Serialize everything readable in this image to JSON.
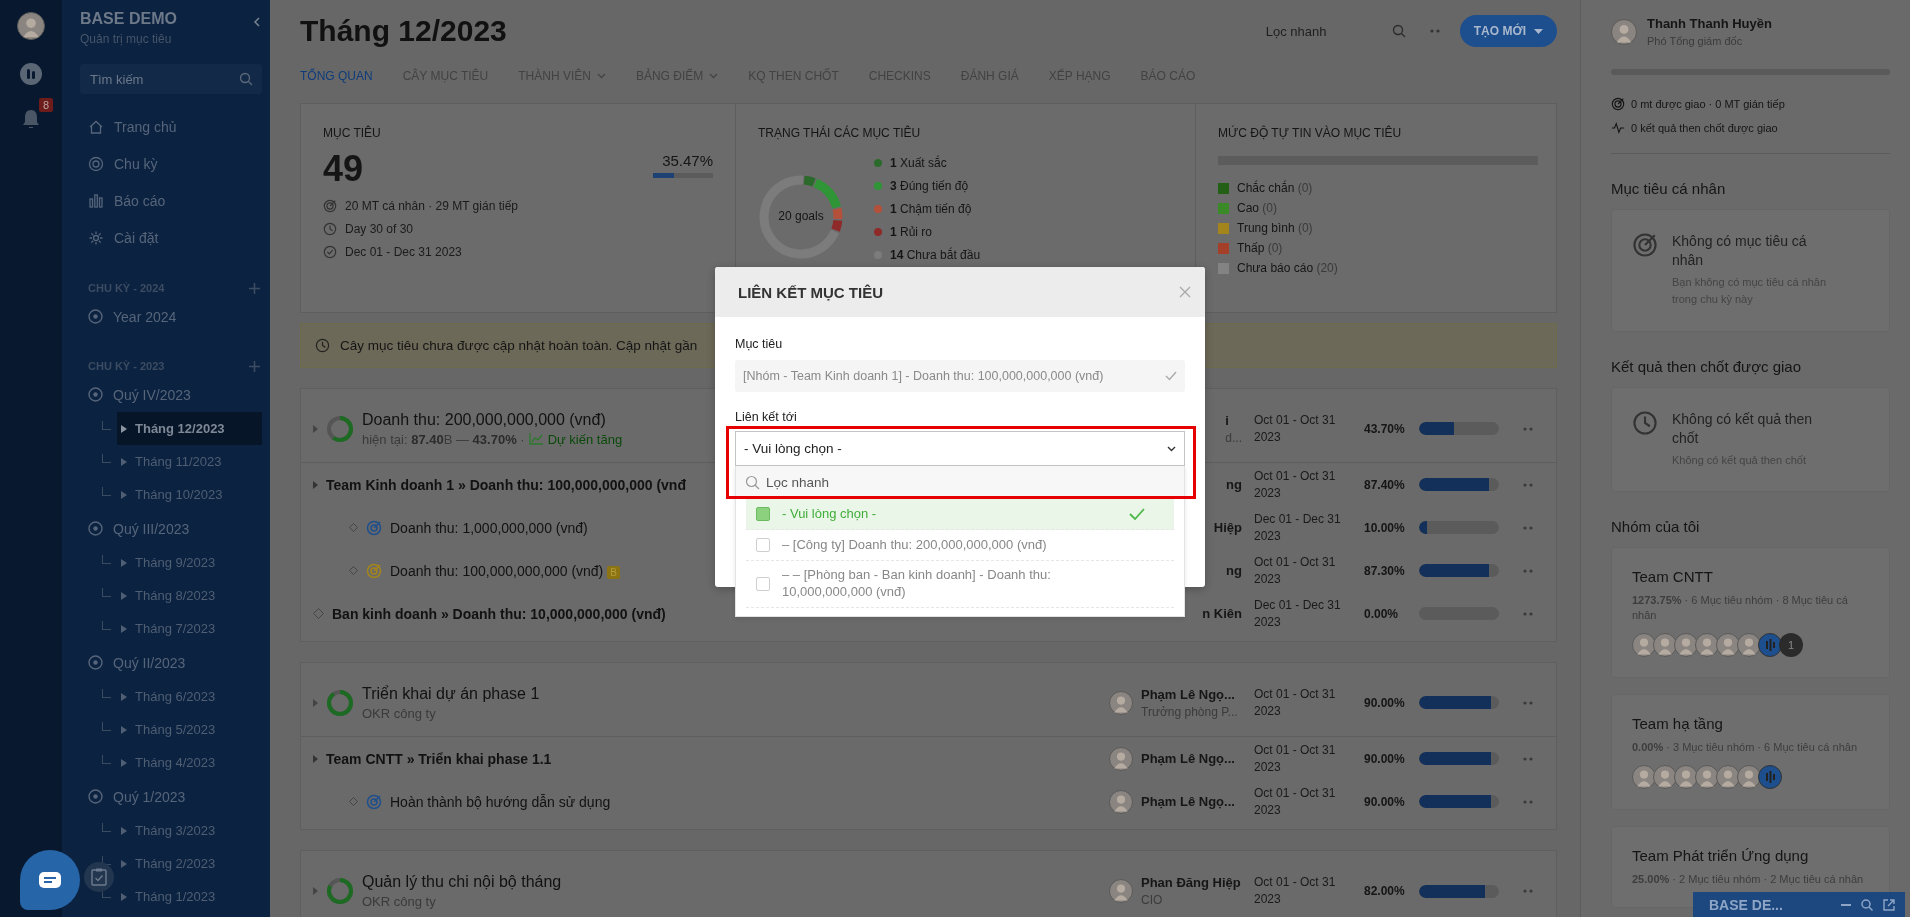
{
  "rail": {
    "notifications": "8"
  },
  "sidebar": {
    "title": "BASE DEMO",
    "subtitle": "Quản trị mục tiêu",
    "search": {
      "placeholder": "Tìm kiếm"
    },
    "nav": [
      {
        "label": "Trang chủ"
      },
      {
        "label": "Chu kỳ"
      },
      {
        "label": "Báo cáo"
      },
      {
        "label": "Cài đặt"
      }
    ],
    "cycles": [
      {
        "title": "CHU KỲ - 2024",
        "items": [
          {
            "label": "Year 2024",
            "selected": false
          }
        ]
      },
      {
        "title": "CHU KỲ - 2023",
        "items": [
          {
            "label": "Quý IV/2023",
            "selected": false,
            "children": [
              {
                "label": "Tháng 12/2023",
                "selected": true
              },
              {
                "label": "Tháng 11/2023",
                "selected": false
              },
              {
                "label": "Tháng 10/2023",
                "selected": false
              }
            ]
          },
          {
            "label": "Quý III/2023",
            "selected": false,
            "children": [
              {
                "label": "Tháng 9/2023",
                "selected": false
              },
              {
                "label": "Tháng 8/2023",
                "selected": false
              },
              {
                "label": "Tháng 7/2023",
                "selected": false
              }
            ]
          },
          {
            "label": "Quý II/2023",
            "selected": false,
            "children": [
              {
                "label": "Tháng 6/2023",
                "selected": false
              },
              {
                "label": "Tháng 5/2023",
                "selected": false
              },
              {
                "label": "Tháng 4/2023",
                "selected": false
              }
            ]
          },
          {
            "label": "Quý 1/2023",
            "selected": false,
            "children": [
              {
                "label": "Tháng 3/2023",
                "selected": false
              },
              {
                "label": "Tháng 2/2023",
                "selected": false
              },
              {
                "label": "Tháng 1/2023",
                "selected": false
              }
            ]
          }
        ]
      }
    ]
  },
  "header": {
    "title": "Tháng 12/2023",
    "search": {
      "placeholder": "Lọc nhanh"
    },
    "create_button": "TẠO MỚI"
  },
  "tabs": [
    {
      "label": "TỔNG QUAN",
      "selected": true,
      "dropdown": false
    },
    {
      "label": "CÂY MỤC TIÊU",
      "selected": false,
      "dropdown": false
    },
    {
      "label": "THÀNH VIÊN",
      "selected": false,
      "dropdown": true
    },
    {
      "label": "BẢNG ĐIỂM",
      "selected": false,
      "dropdown": true
    },
    {
      "label": "KQ THEN CHỐT",
      "selected": false,
      "dropdown": false
    },
    {
      "label": "CHECKINS",
      "selected": false,
      "dropdown": false
    },
    {
      "label": "ĐÁNH GIÁ",
      "selected": false,
      "dropdown": false
    },
    {
      "label": "XẾP HẠNG",
      "selected": false,
      "dropdown": false
    },
    {
      "label": "BÁO CÁO",
      "selected": false,
      "dropdown": false
    }
  ],
  "overview": {
    "objectives": {
      "label": "MỤC TIÊU",
      "value": "49",
      "percent": "35.47%",
      "level": 0.3547,
      "facts": [
        {
          "text": "20 MT cá nhân · 29 MT gián tiếp"
        },
        {
          "text": "Day 30 of 30"
        },
        {
          "text": "Dec 01 - Dec 31 2023"
        }
      ]
    },
    "status": {
      "label": "TRẠNG THÁI CÁC MỤC TIÊU",
      "center": "20 goals",
      "legend": [
        {
          "count": "1",
          "label": "Xuất sắc",
          "color": "#2c6a2c"
        },
        {
          "count": "3",
          "label": "Đúng tiến độ",
          "color": "#2f9536"
        },
        {
          "count": "1",
          "label": "Chậm tiến độ",
          "color": "#b5503a"
        },
        {
          "count": "1",
          "label": "Rủi ro",
          "color": "#8e2a2a"
        },
        {
          "count": "14",
          "label": "Chưa bắt đầu",
          "color": "#7c7c7c"
        }
      ]
    },
    "confidence": {
      "label": "MỨC ĐỘ TỰ TIN VÀO MỤC TIÊU",
      "legend": [
        {
          "label": "Chắc chắn",
          "count": "(0)",
          "color": "#245f16"
        },
        {
          "label": "Cao",
          "count": "(0)",
          "color": "#3a8a28"
        },
        {
          "label": "Trung bình",
          "count": "(0)",
          "color": "#a3851c"
        },
        {
          "label": "Thấp",
          "count": "(0)",
          "color": "#a4402a"
        },
        {
          "label": "Chưa báo cáo",
          "count": "(20)",
          "color": "#838383"
        }
      ]
    }
  },
  "notice": "Cây mục tiêu chưa được cập nhật hoàn toàn. Cập nhật gần",
  "groups": [
    {
      "rows": [
        {
          "kind": "objective",
          "title": "Doanh thu: 200,000,000,000 (vnđ)",
          "subtitle": "hiện tại: **87.40**B — **43.70%** ·",
          "trend": "Dự kiến tăng",
          "owner": {
            "avatar": false,
            "name": "i",
            "role": "d..."
          },
          "dates": "Oct 01 - Oct 31 2023",
          "percent": "43.70%",
          "level": 0.437,
          "children": [
            {
              "kind": "team",
              "title": "Team Kinh doanh 1 » Doanh thu: 100,000,000,000 (vnđ",
              "owner": {
                "avatar": false,
                "name": "ng"
              },
              "dates": "Oct 01 - Oct 31 2023",
              "percent": "87.40%",
              "level": 0.874,
              "children": [
                {
                  "kind": "kr",
                  "color": "#1f4f8c",
                  "title": "Doanh thu: 1,000,000,000 (vnđ)",
                  "owner": {
                    "avatar": false,
                    "name": "Hiệp"
                  },
                  "dates": "Dec 01 - Dec 31 2023",
                  "percent": "10.00%",
                  "level": 0.1
                },
                {
                  "kind": "kr",
                  "color": "#a3851c",
                  "title": "Doanh thu: 100,000,000,000 (vnđ)",
                  "badge": "B",
                  "owner": {
                    "avatar": false,
                    "name": "ng"
                  },
                  "dates": "Oct 01 - Oct 31 2023",
                  "percent": "87.30%",
                  "level": 0.873
                }
              ]
            },
            {
              "kind": "link",
              "title": "Ban kinh doanh » Doanh thu: 10,000,000,000 (vnđ)",
              "owner": {
                "avatar": false,
                "name": "n Kiên"
              },
              "dates": "Dec 01 - Dec 31 2023",
              "percent": "0.00%",
              "level": 0
            }
          ]
        }
      ]
    },
    {
      "rows": [
        {
          "kind": "objective",
          "title": "Triển khai dự án phase 1",
          "subtitle": "OKR công ty",
          "owner": {
            "avatar": true,
            "name": "Phạm Lê Ngọ...",
            "role": "Trưởng phòng P..."
          },
          "dates": "Oct 01 - Oct 31 2023",
          "percent": "90.00%",
          "level": 0.9,
          "children": [
            {
              "kind": "team",
              "title": "Team CNTT » Triển khai phase 1.1",
              "owner": {
                "avatar": true,
                "name": "Phạm Lê Ngọ..."
              },
              "dates": "Oct 01 - Oct 31 2023",
              "percent": "90.00%",
              "level": 0.9,
              "children": [
                {
                  "kind": "kr",
                  "color": "#1f4f8c",
                  "title": "Hoàn thành bộ hướng dẫn sử dụng",
                  "owner": {
                    "avatar": true,
                    "name": "Phạm Lê Ngọ..."
                  },
                  "dates": "Oct 01 - Oct 31 2023",
                  "percent": "90.00%",
                  "level": 0.9
                }
              ]
            }
          ]
        }
      ]
    },
    {
      "rows": [
        {
          "kind": "objective",
          "title": "Quản lý thu chi nội bộ tháng",
          "subtitle": "OKR công ty",
          "owner": {
            "avatar": true,
            "name": "Phan Đăng Hiệp",
            "role": "CIO"
          },
          "dates": "Oct 01 - Oct 31 2023",
          "percent": "82.00%",
          "level": 0.82
        }
      ]
    }
  ],
  "profile": {
    "name": "Thanh Thanh Huyền",
    "role": "Phó Tổng giám đốc",
    "level": 0,
    "stats": [
      {
        "text": "0 mt được giao · 0 MT gián tiếp"
      },
      {
        "text": "0 kết quả then chốt được giao"
      }
    ]
  },
  "panels": [
    {
      "title": "Mục tiêu cá nhân",
      "empty": {
        "title": "Không có mục tiêu cá nhân",
        "text": "Bạn không có mục tiêu cá nhân trong chu kỳ này"
      }
    },
    {
      "title": "Kết quả then chốt được giao",
      "empty": {
        "title": "Không có kết quả then chốt",
        "text": "Không có kết quả then chốt"
      }
    }
  ],
  "teams": {
    "title": "Nhóm của tôi",
    "items": [
      {
        "name": "Team CNTT",
        "stats": "**1273.75%** · 6 Mục tiêu nhóm · 8 Mục tiêu cá nhân",
        "members": [
          {
            "kind": "person"
          },
          {
            "kind": "person"
          },
          {
            "kind": "person"
          },
          {
            "kind": "person"
          },
          {
            "kind": "person"
          },
          {
            "kind": "person"
          },
          {
            "kind": "app"
          },
          {
            "kind": "more",
            "text": "1"
          }
        ]
      },
      {
        "name": "Team hạ tầng",
        "stats": "**0.00%** · 3 Mục tiêu nhóm · 6 Mục tiêu cá nhân",
        "members": [
          {
            "kind": "person"
          },
          {
            "kind": "person"
          },
          {
            "kind": "person"
          },
          {
            "kind": "person"
          },
          {
            "kind": "person"
          },
          {
            "kind": "person"
          },
          {
            "kind": "app"
          }
        ]
      },
      {
        "name": "Team Phát triển Ứng dụng",
        "stats": "**25.00%** · 2 Mục tiêu nhóm · 2 Mục tiêu cá nhân"
      }
    ]
  },
  "chat_widget": {
    "title": "BASE DE..."
  },
  "modal": {
    "title": "LIÊN KẾT MỤC TIÊU",
    "objective_label": "Mục tiêu",
    "objective_value": "[Nhóm - Team Kinh doanh 1] - Doanh thu: 100,000,000,000 (vnđ)",
    "link_label": "Liên kết tới",
    "select": {
      "value": "- Vui lòng chọn -",
      "expanded": true,
      "search": {
        "placeholder": "Lọc nhanh"
      },
      "options": [
        {
          "label": "- Vui lòng chọn -",
          "selected": true
        },
        {
          "label": "– [Công ty] Doanh thu: 200,000,000,000 (vnđ)",
          "selected": false
        },
        {
          "label": "– – [Phòng ban - Ban kinh doanh] - Doanh thu: 10,000,000,000 (vnđ)",
          "selected": false
        }
      ]
    }
  }
}
